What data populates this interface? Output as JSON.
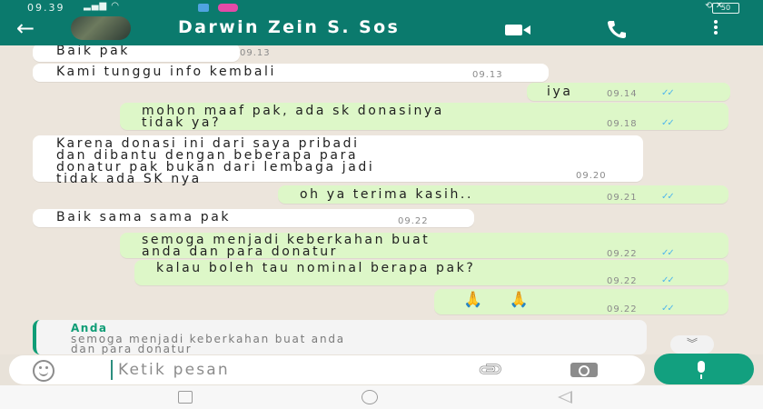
{
  "status": {
    "time": "09.39",
    "battery": "50"
  },
  "header": {
    "title": "Darwin Zein S. Sos"
  },
  "messages": [
    {
      "dir": "in",
      "text": "Baik pak",
      "time": "09.13"
    },
    {
      "dir": "in",
      "text": "Kami tunggu info kembali",
      "time": "09.13"
    },
    {
      "dir": "out",
      "text": "iya",
      "time": "09.14"
    },
    {
      "dir": "out",
      "text": "mohon maaf pak, ada sk donasinya\ntidak ya?",
      "time": "09.18"
    },
    {
      "dir": "in",
      "text": "Karena donasi ini dari saya pribadi\ndan dibantu dengan beberapa para\ndonatur pak bukan dari lembaga jadi\ntidak ada SK nya",
      "time": "09.20"
    },
    {
      "dir": "out",
      "text": "oh ya terima kasih..",
      "time": "09.21"
    },
    {
      "dir": "in",
      "text": "Baik sama sama pak",
      "time": "09.22"
    },
    {
      "dir": "out",
      "text": "semoga menjadi keberkahan buat\nanda dan para donatur",
      "time": "09.22"
    },
    {
      "dir": "out",
      "text": "kalau boleh tau nominal berapa pak?",
      "time": "09.22"
    },
    {
      "dir": "out",
      "text": "🙏 🙏",
      "time": "09.22"
    }
  ],
  "reply_preview": {
    "author": "Anda",
    "text": "semoga menjadi keberkahan buat anda\ndan para donatur"
  },
  "input": {
    "placeholder": "Ketik pesan"
  },
  "icons": {
    "back": "arrow-left-icon",
    "video": "video-call-icon",
    "call": "phone-icon",
    "menu": "more-vert-icon",
    "emoji": "emoji-icon",
    "attach": "paperclip-icon",
    "camera": "camera-icon",
    "mic": "mic-icon"
  },
  "colors": {
    "header": "#0b7a6d",
    "outgoing": "#ddf7c8",
    "incoming": "#ffffff",
    "ticks": "#4fb6ec",
    "accent": "#12a07f"
  }
}
